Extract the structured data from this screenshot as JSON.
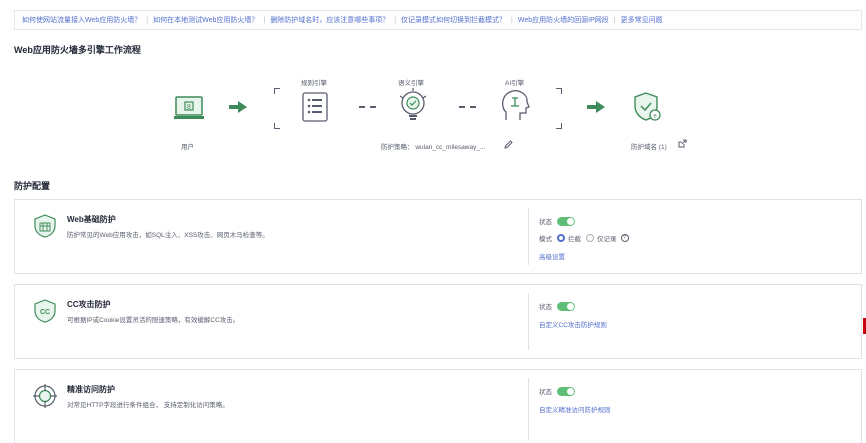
{
  "faq": [
    "如何使网站流量接入Web应用防火墙？",
    "如何在本地测试Web应用防火墙？",
    "删除防护域名时，应该注意哪些事项？",
    "仅记录模式如何切换到拦截模式？",
    "Web应用防火墙的回源IP网段",
    "更多常见问题"
  ],
  "workflow": {
    "title": "Web应用防火墙多引擎工作流程",
    "user_label": "用户",
    "engines": [
      "规则引擎",
      "语义引擎",
      "AI引擎"
    ],
    "policy_label": "防护策略：",
    "policy_value": "wulan_cc_milesaway_...",
    "domain_label": "防护域名 (1)"
  },
  "config": {
    "title": "防护配置",
    "status_label": "状态",
    "mode_label": "模式",
    "mode_block": "拦截",
    "mode_log": "仅记录",
    "help_glyph": "?"
  },
  "cards": [
    {
      "title": "Web基础防护",
      "desc": "防护常见的Web应用攻击，如SQL注入、XSS攻击、网页木马检查等。",
      "link": "高级设置"
    },
    {
      "title": "CC攻击防护",
      "desc": "可根据IP或Cookie设置灵活的限速策略，有效缓解CC攻击。",
      "link": "自定义CC攻击防护规则",
      "icon_text": "CC"
    },
    {
      "title": "精准访问防护",
      "desc": "对常见HTTP字段进行条件组合， 支持定制化访问策略。",
      "link": "自定义精准访问防护规则"
    }
  ],
  "colors": {
    "accent": "#526ecc",
    "icon_green": "#3d8b5a",
    "toggle_on": "#5fbf78"
  }
}
